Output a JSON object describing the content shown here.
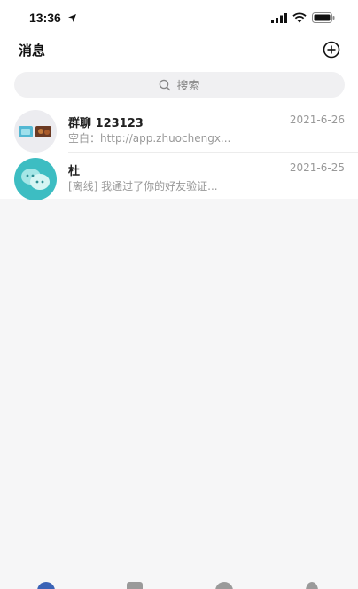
{
  "status_bar": {
    "time": "13:36"
  },
  "header": {
    "title": "消息"
  },
  "search": {
    "placeholder": "搜索"
  },
  "conversations": [
    {
      "name": "群聊 123123",
      "date": "2021-6-26",
      "preview": "空白：http://app.zhuochengx..."
    },
    {
      "name": "杜",
      "date": "2021-6-25",
      "preview": "[离线] 我通过了你的好友验证..."
    }
  ],
  "icons": {
    "status": [
      "location-arrow-icon",
      "signal-icon",
      "wifi-icon",
      "battery-icon"
    ],
    "header": "add-circle-icon",
    "search": "search-icon",
    "tabbar": [
      "messages-tab-icon",
      "contacts-tab-icon",
      "discover-tab-icon",
      "profile-tab-icon"
    ]
  },
  "colors": {
    "accent_blue": "#3b63b6",
    "friend_avatar": "#3dbdc2",
    "tab_gray": "#9a9a9a"
  }
}
